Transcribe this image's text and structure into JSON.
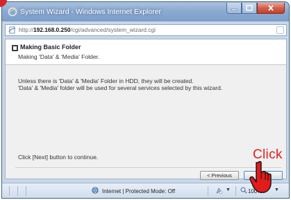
{
  "window": {
    "title": "System Wizard - Windows Internet Explorer"
  },
  "address": {
    "prefix": "http://",
    "host": "192.168.0.250",
    "path": "/cgi/advanced/system_wizard.cgi"
  },
  "wizard": {
    "title": "Making Basic Folder",
    "subtitle": "Making 'Data' & 'Media' Folder.",
    "line1": "Unless there is 'Data' & 'Media' Folder in HDD, they will be created.",
    "line2": "'Data' & 'Media' folder will be used for several services selected by this wizard.",
    "continue": "Click [Next] button to continue.",
    "prev_label": "< Previous",
    "next_label": "Next >"
  },
  "status": {
    "zone": "Internet | Protected Mode: Off",
    "zoom": "100%"
  },
  "annotation": {
    "label": "Click"
  },
  "colors": {
    "annotation": "#e01c1c",
    "titlebar": "#8cabd2",
    "close_button": "#c5402a"
  },
  "icons": [
    "ie-icon",
    "page-icon",
    "folder-icon",
    "globe-icon",
    "security-icon",
    "zoom-icon",
    "hand-pointer-icon"
  ]
}
